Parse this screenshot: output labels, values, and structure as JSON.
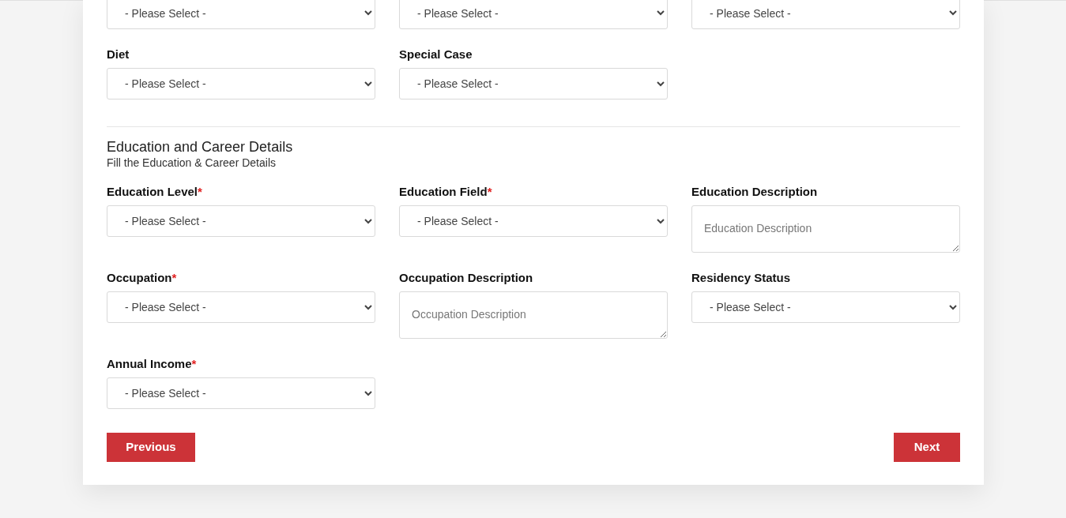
{
  "top_row": [
    {
      "kind": "select",
      "value": "- Please Select -"
    },
    {
      "kind": "select",
      "value": "- Please Select -"
    },
    {
      "kind": "select",
      "value": "- Please Select -"
    }
  ],
  "preference_fields": [
    {
      "label": "Diet",
      "kind": "select",
      "value": "- Please Select -"
    },
    {
      "label": "Special Case",
      "kind": "select",
      "value": "- Please Select -"
    }
  ],
  "section": {
    "title": "Education and Career Details",
    "subtitle": "Fill the Education & Career Details"
  },
  "fields": [
    {
      "label": "Education Level",
      "required_mark": "*",
      "kind": "select",
      "value": "- Please Select -"
    },
    {
      "label": "Education Field",
      "required_mark": "*",
      "kind": "select",
      "value": "- Please Select -"
    },
    {
      "label": "Education Description",
      "kind": "textarea",
      "placeholder": "Education Description"
    },
    {
      "label": "Occupation",
      "required_mark": "*",
      "kind": "select",
      "value": "- Please Select -"
    },
    {
      "label": "Occupation Description",
      "kind": "textarea",
      "placeholder": "Occupation Description"
    },
    {
      "label": "Residency Status",
      "kind": "select",
      "value": "- Please Select -"
    },
    {
      "label": "Annual Income",
      "required_mark": "*",
      "kind": "select",
      "value": "- Please Select -"
    }
  ],
  "buttons": {
    "previous": "Previous",
    "next": "Next"
  }
}
